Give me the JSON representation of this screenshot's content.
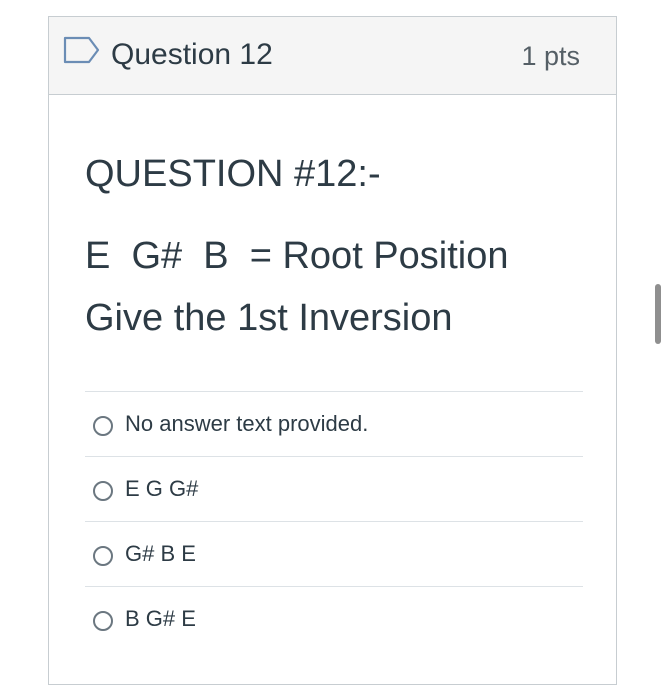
{
  "question": {
    "title": "Question 12",
    "points": "1 pts",
    "body": {
      "line1": "QUESTION #12:-",
      "line2": "E  G#  B  = Root Position",
      "line3": "Give the 1st Inversion"
    }
  },
  "answers": [
    {
      "label": "No answer text provided."
    },
    {
      "label": "E G G#"
    },
    {
      "label": "G# B E"
    },
    {
      "label": "B G# E"
    }
  ],
  "icons": {
    "flag": "bookmark-flag-icon"
  },
  "colors": {
    "header_bg": "#f5f5f5",
    "border": "#c7cdd1",
    "text": "#2d3b45",
    "flag": "#6b8db5"
  }
}
